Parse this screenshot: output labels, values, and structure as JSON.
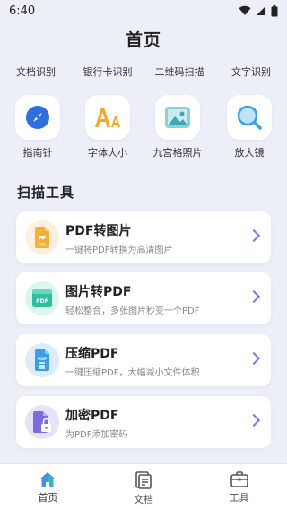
{
  "status": {
    "time": "6:40"
  },
  "page": {
    "title": "首页"
  },
  "features_top": [
    "文档识别",
    "银行卡识别",
    "二维码扫描",
    "文字识别"
  ],
  "tools_grid": [
    {
      "label": "指南针",
      "icon": "compass-icon"
    },
    {
      "label": "字体大小",
      "icon": "font-size-icon"
    },
    {
      "label": "九宫格照片",
      "icon": "grid-photo-icon"
    },
    {
      "label": "放大镜",
      "icon": "magnifier-icon"
    }
  ],
  "scan_section": {
    "title": "扫描工具"
  },
  "scan_tools": [
    {
      "title": "PDF转图片",
      "desc": "一键将PDF转换为高清图片",
      "icon": "pdf-to-image-icon",
      "color": "#f5b03a",
      "bg": "#fdf1dd"
    },
    {
      "title": "图片转PDF",
      "desc": "轻松整合，多张图片秒变一个PDF",
      "icon": "image-to-pdf-icon",
      "color": "#2fbfa0",
      "bg": "#dcf5ef"
    },
    {
      "title": "压缩PDF",
      "desc": "一键压缩PDF，大幅减小文件体积",
      "icon": "compress-pdf-icon",
      "color": "#3c9ee8",
      "bg": "#dcecfa"
    },
    {
      "title": "加密PDF",
      "desc": "为PDF添加密码",
      "icon": "encrypt-pdf-icon",
      "color": "#7d6be0",
      "bg": "#e6e2f8"
    }
  ],
  "bottom_nav": [
    {
      "label": "首页",
      "icon": "home-icon",
      "active": true
    },
    {
      "label": "文档",
      "icon": "document-icon",
      "active": false
    },
    {
      "label": "工具",
      "icon": "toolbox-icon",
      "active": false
    }
  ],
  "colors": {
    "accent": "#4b8de8",
    "background": "#eceef8",
    "chevron": "#6b7fe6"
  }
}
